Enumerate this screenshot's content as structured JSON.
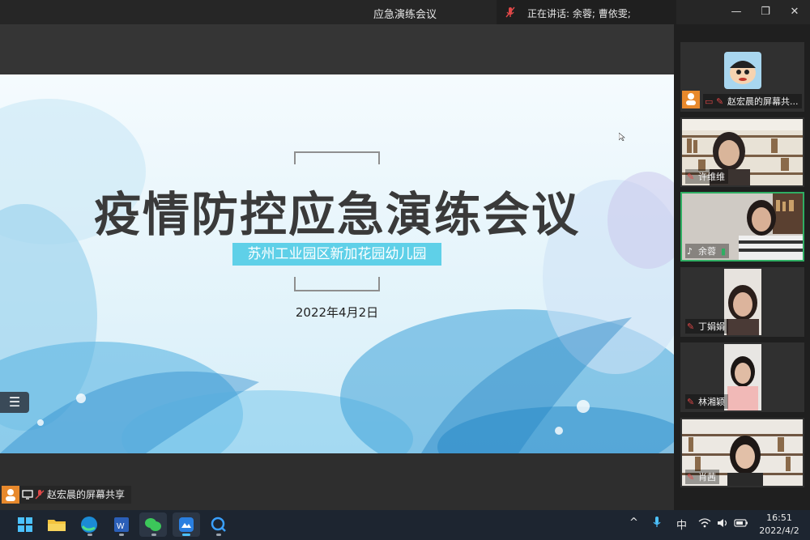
{
  "window": {
    "title": "应急演练会议",
    "speaking": "正在讲话: 余蓉; 曹依雯;",
    "controls": [
      "—",
      "❐",
      "✕"
    ]
  },
  "slide": {
    "title": "疫情防控应急演练会议",
    "subtitle": "苏州工业园区新加花园幼儿园",
    "date": "2022年4月2日",
    "list_button": "☰"
  },
  "share_label": "赵宏晨的屏幕共享",
  "participants": [
    {
      "name": "赵宏晨的屏幕共..."
    },
    {
      "name": "许维维"
    },
    {
      "name": "余蓉"
    },
    {
      "name": "丁娟娟"
    },
    {
      "name": "林湘颖"
    },
    {
      "name": "肖茜"
    }
  ],
  "taskbar": {
    "apps": [
      "windows-start-icon",
      "file-explorer-icon",
      "edge-browser-icon",
      "word-icon",
      "wechat-icon",
      "meeting-app-icon",
      "search-app-icon"
    ],
    "tray": {
      "chevron": "^",
      "ime": "中"
    },
    "time": "16:51",
    "date": "2022/4/2"
  },
  "colors": {
    "accent_green": "#2fae63",
    "subtitle_bg": "#5fd0e8",
    "avatar_orange": "#e8892c",
    "taskbar": "#1d2530"
  }
}
